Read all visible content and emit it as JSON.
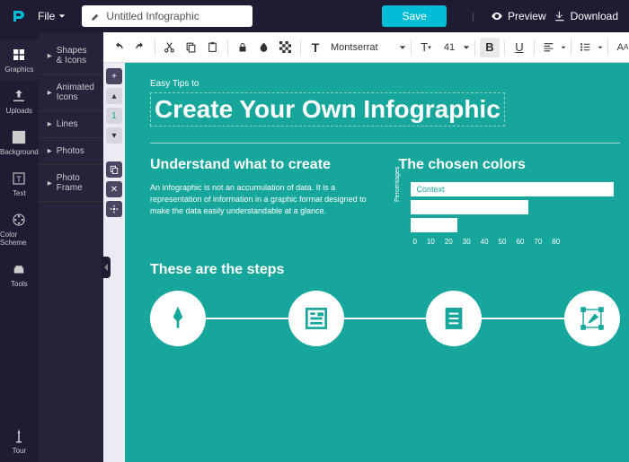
{
  "topbar": {
    "file": "File",
    "title": "Untitled Infographic",
    "save": "Save",
    "preview": "Preview",
    "download": "Download"
  },
  "nav": {
    "graphics": "Graphics",
    "uploads": "Uploads",
    "background": "Background",
    "text": "Text",
    "color": "Color Scheme",
    "tools": "Tools",
    "tour": "Tour"
  },
  "panel": {
    "shapes": "Shapes & Icons",
    "animated": "Animated Icons",
    "lines": "Lines",
    "photos": "Photos",
    "frame": "Photo Frame"
  },
  "toolbar": {
    "font": "Montserrat",
    "size": "41"
  },
  "pageControls": {
    "page": "1"
  },
  "canvas": {
    "subtitle": "Easy Tips to",
    "title": "Create Your Own Infographic",
    "section1": {
      "heading": "Understand what to create",
      "body": "An infographic is not an accumulation of data. It is a representation of information in a graphic format designed to make the data easily understandable at a glance."
    },
    "section2": {
      "heading": "The chosen colors"
    },
    "steps": {
      "heading": "These are the steps"
    }
  },
  "chart_data": {
    "type": "bar",
    "orientation": "horizontal",
    "ylabel": "Percentages",
    "categories": [
      "Context",
      "",
      ""
    ],
    "values": [
      78,
      45,
      18
    ],
    "xticks": [
      0,
      10,
      20,
      30,
      40,
      50,
      60,
      70,
      80
    ],
    "xlim": [
      0,
      80
    ]
  }
}
